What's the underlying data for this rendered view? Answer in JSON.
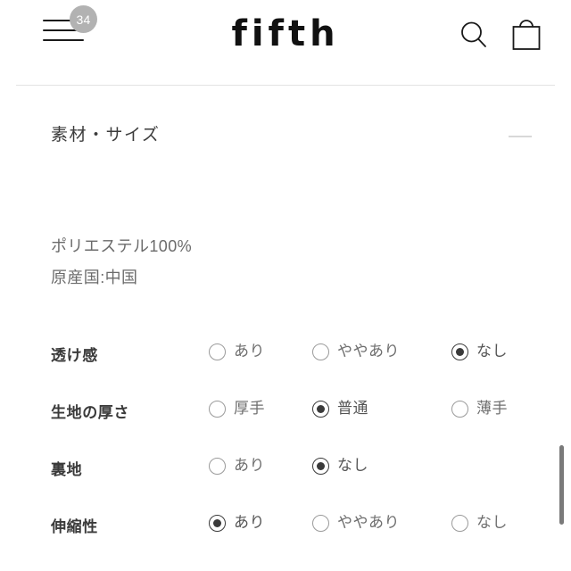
{
  "header": {
    "menu_icon": "hamburger-menu-icon",
    "menu_badge_count": "34",
    "brand": "fifth",
    "search_icon": "search-icon",
    "bag_icon": "shopping-bag-icon"
  },
  "section": {
    "title": "素材・サイズ",
    "toggle_icon": "minus-collapse-icon",
    "expanded": true
  },
  "material": {
    "composition": "ポリエステル100%",
    "origin": "原産国:中国"
  },
  "specs": [
    {
      "label": "透け感",
      "options": [
        {
          "label": "あり",
          "selected": false
        },
        {
          "label": "ややあり",
          "selected": false
        },
        {
          "label": "なし",
          "selected": true
        }
      ]
    },
    {
      "label": "生地の厚さ",
      "options": [
        {
          "label": "厚手",
          "selected": false
        },
        {
          "label": "普通",
          "selected": true
        },
        {
          "label": "薄手",
          "selected": false
        }
      ]
    },
    {
      "label": "裏地",
      "options": [
        {
          "label": "あり",
          "selected": false
        },
        {
          "label": "なし",
          "selected": true
        }
      ]
    },
    {
      "label": "伸縮性",
      "options": [
        {
          "label": "あり",
          "selected": true
        },
        {
          "label": "ややあり",
          "selected": false
        },
        {
          "label": "なし",
          "selected": false
        }
      ]
    }
  ],
  "scrollbar": {
    "name": "vertical-scrollbar"
  },
  "colors": {
    "text_dark": "#3a3a3a",
    "text_muted": "#6e6e6e",
    "badge_bg": "#b2b2b2",
    "divider": "#e3e3e3",
    "scrollbar": "#7a7a7a"
  }
}
